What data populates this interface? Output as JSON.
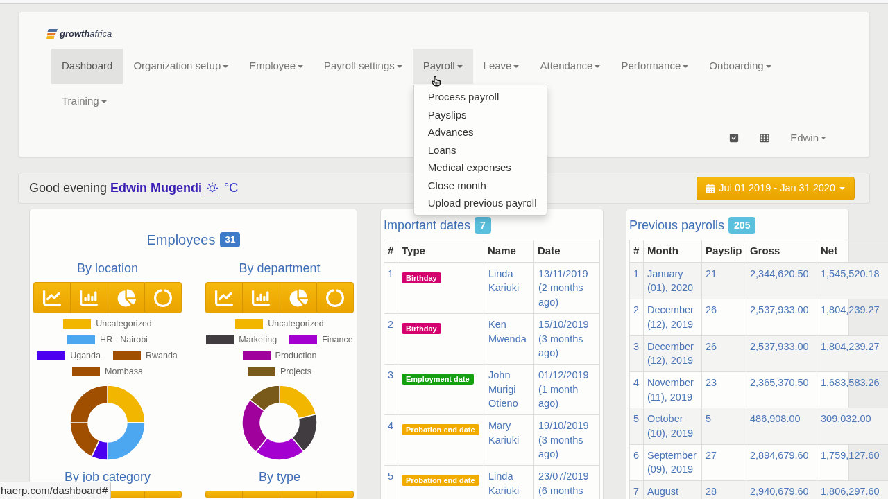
{
  "logo": {
    "name_bold": "growth",
    "name_light": "africa"
  },
  "nav": {
    "items": [
      {
        "label": "Dashboard",
        "selected": true,
        "expanded": false,
        "dropdown": false
      },
      {
        "label": "Organization setup",
        "selected": false,
        "expanded": false,
        "dropdown": true
      },
      {
        "label": "Employee",
        "selected": false,
        "expanded": false,
        "dropdown": true
      },
      {
        "label": "Payroll settings",
        "selected": false,
        "expanded": false,
        "dropdown": true
      },
      {
        "label": "Payroll",
        "selected": false,
        "expanded": true,
        "dropdown": true,
        "menu": [
          "Process payroll",
          "Payslips",
          "Advances",
          "Loans",
          "Medical expenses",
          "Close month",
          "Upload previous payroll"
        ]
      },
      {
        "label": "Leave",
        "selected": false,
        "expanded": false,
        "dropdown": true
      },
      {
        "label": "Attendance",
        "selected": false,
        "expanded": false,
        "dropdown": true
      },
      {
        "label": "Performance",
        "selected": false,
        "expanded": false,
        "dropdown": true
      },
      {
        "label": "Onboarding",
        "selected": false,
        "expanded": false,
        "dropdown": true
      },
      {
        "label": "Training",
        "selected": false,
        "expanded": false,
        "dropdown": true
      }
    ]
  },
  "user_menu": {
    "label": "Edwin"
  },
  "greeting": {
    "salutation": "Good evening",
    "name": "Edwin Mugendi",
    "unit": "°C"
  },
  "date_range": {
    "label": "Jul 01 2019 - Jan 31 2020"
  },
  "employees": {
    "title": "Employees",
    "count": "31",
    "charts": [
      {
        "title": "By location",
        "legend": [
          {
            "label": "Uncategorized",
            "color": "#f2b600"
          },
          {
            "label": "HR - Nairobi",
            "color": "#4da6f0"
          },
          {
            "label": "Uganda",
            "color": "#4b00f0"
          },
          {
            "label": "Rwanda",
            "color": "#a04f00"
          },
          {
            "label": "Mombasa",
            "color": "#a04f00"
          }
        ]
      },
      {
        "title": "By department",
        "legend": [
          {
            "label": "Uncategorized",
            "color": "#f2b600"
          },
          {
            "label": "Marketing",
            "color": "#403c40"
          },
          {
            "label": "Finance",
            "color": "#a400d0"
          },
          {
            "label": "Production",
            "color": "#a0009c"
          },
          {
            "label": "Projects",
            "color": "#7a5a1a"
          }
        ]
      },
      {
        "title": "By job category"
      },
      {
        "title": "By type"
      }
    ]
  },
  "important_dates": {
    "title": "Important dates",
    "count": "7",
    "columns": [
      "#",
      "Type",
      "Name",
      "Date"
    ],
    "rows": [
      {
        "number": "1",
        "type": "Birthday",
        "color": "#d4006e",
        "name": "Linda Kariuki",
        "date": "13/11/2019 (2 months ago)"
      },
      {
        "number": "2",
        "type": "Birthday",
        "color": "#d4006e",
        "name": "Ken Mwenda",
        "date": "15/10/2019 (3 months ago)"
      },
      {
        "number": "3",
        "type": "Employment date",
        "color": "#14a010",
        "name": "John Murigi Otieno",
        "date": "01/12/2019 (1 month ago)"
      },
      {
        "number": "4",
        "type": "Probation end date",
        "color": "#f2ac00",
        "name": "Mary Kariuki",
        "date": "19/10/2019 (3 months ago)"
      },
      {
        "number": "5",
        "type": "Probation end date",
        "color": "#f2ac00",
        "name": "Linda Kariuki",
        "date": "23/07/2019 (6 months"
      }
    ]
  },
  "previous_payrolls": {
    "title": "Previous payrolls",
    "count": "205",
    "columns": [
      "#",
      "Month",
      "Payslip",
      "Gross",
      "Net"
    ],
    "rows": [
      {
        "number": "1",
        "month": "January (01), 2020",
        "payslips": "21",
        "gross": "2,344,620.50",
        "net": "1,545,520.18"
      },
      {
        "number": "2",
        "month": "December (12), 2019",
        "payslips": "26",
        "gross": "2,537,933.00",
        "net": "1,804,239.27"
      },
      {
        "number": "3",
        "month": "December (12), 2019",
        "payslips": "26",
        "gross": "2,537,933.00",
        "net": "1,804,239.27"
      },
      {
        "number": "4",
        "month": "November (11), 2019",
        "payslips": "23",
        "gross": "2,365,370.50",
        "net": "1,683,583.26"
      },
      {
        "number": "5",
        "month": "October (10), 2019",
        "payslips": "5",
        "gross": "486,908.00",
        "net": "309,032.00"
      },
      {
        "number": "6",
        "month": "September (09), 2019",
        "payslips": "27",
        "gross": "2,894,679.60",
        "net": "1,759,127.60"
      },
      {
        "number": "7",
        "month": "August",
        "payslips": "28",
        "gross": "2,940,679.60",
        "net": "1,806,297.60"
      }
    ]
  },
  "status_bar": {
    "url": "haerp.com/dashboard#"
  }
}
